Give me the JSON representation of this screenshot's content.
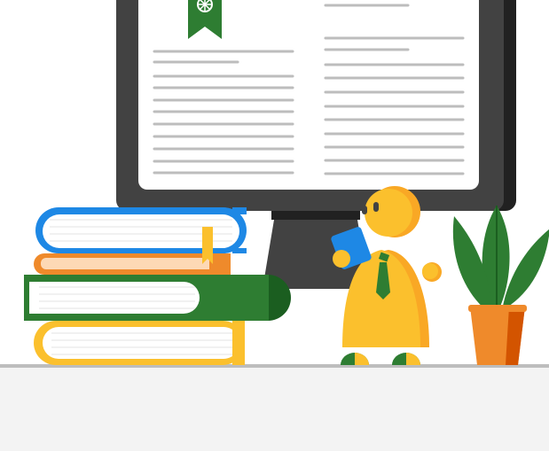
{
  "illustration": {
    "subject": "reading-at-computer",
    "icons": [
      "monitor-icon",
      "book-stack-icon",
      "bookmark-icon",
      "person-reading-icon",
      "plant-icon"
    ]
  },
  "colors": {
    "desk": "#f3f3f3",
    "desk_edge": "#bdbdbd",
    "monitor_bezel": "#424242",
    "monitor_shadow": "#212121",
    "screen": "#ffffff",
    "text_line": "#bdbdbd",
    "green": "#2e7d32",
    "dark_green": "#1b5e20",
    "yellow": "#fbc02d",
    "dark_yellow": "#f9a825",
    "blue": "#1e88e5",
    "orange": "#ef8a2b",
    "dark_orange": "#d35400",
    "light_orange": "#fdd9b5",
    "page_white": "#ffffff"
  }
}
